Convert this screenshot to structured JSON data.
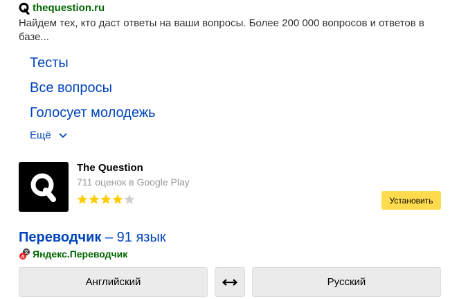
{
  "result": {
    "site": "thequestion.ru",
    "snippet": "Найдем тех, кто даст ответы на ваши вопросы. Более 200 000 вопросов и ответов в базе...",
    "sitelinks": [
      "Тесты",
      "Все вопросы",
      "Голосует молодежь"
    ],
    "more_label": "Ещё",
    "logo_icon": "q-logo-icon"
  },
  "app": {
    "name": "The Question",
    "rating_text": "711 оценок в Google Play",
    "rating": 4,
    "rating_max": 5,
    "install_label": "Установить",
    "icon": "q-logo-icon",
    "install_color": "#ffdb4d"
  },
  "translator": {
    "title_bold": "Переводчик",
    "title_rest": " – 91 язык",
    "source": "Яндекс.Переводчик",
    "source_icon": "yandex-translate-icon",
    "from_lang": "Английский",
    "to_lang": "Русский",
    "swap_icon": "swap-arrows-icon"
  },
  "colors": {
    "link_blue": "#0044bb",
    "url_green": "#006600",
    "star_filled": "#ffcc00",
    "star_empty": "#d0d0d0"
  }
}
